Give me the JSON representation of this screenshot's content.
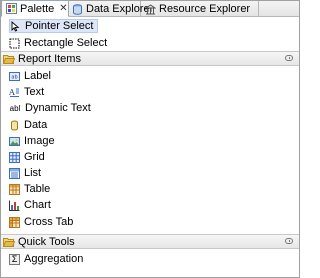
{
  "tabs": [
    {
      "label": "Palette",
      "icon": "palette-icon",
      "active": true
    },
    {
      "label": "Data Explorer",
      "icon": "data-explorer-icon",
      "active": false
    },
    {
      "label": "Resource Explorer",
      "icon": "resource-explorer-icon",
      "active": false
    }
  ],
  "close_glyph": "✕",
  "tools": [
    {
      "label": "Pointer Select",
      "icon": "pointer-icon",
      "selected": true
    },
    {
      "label": "Rectangle Select",
      "icon": "marquee-icon",
      "selected": false
    }
  ],
  "report_items": {
    "title": "Report Items",
    "items": [
      {
        "label": "Label",
        "icon": "label-icon"
      },
      {
        "label": "Text",
        "icon": "text-icon"
      },
      {
        "label": "Dynamic Text",
        "icon": "dynamic-text-icon",
        "glyph": "abl"
      },
      {
        "label": "Data",
        "icon": "data-icon"
      },
      {
        "label": "Image",
        "icon": "image-icon"
      },
      {
        "label": "Grid",
        "icon": "grid-icon"
      },
      {
        "label": "List",
        "icon": "list-icon"
      },
      {
        "label": "Table",
        "icon": "table-icon"
      },
      {
        "label": "Chart",
        "icon": "chart-icon"
      },
      {
        "label": "Cross Tab",
        "icon": "cross-tab-icon"
      }
    ]
  },
  "quick_tools": {
    "title": "Quick Tools",
    "items": [
      {
        "label": "Aggregation",
        "icon": "aggregation-icon",
        "glyph": "Σ"
      }
    ]
  },
  "colors": {
    "selection": "#dce6f6",
    "folder": "#e8b84a",
    "icon_blue": "#3b6fc4"
  }
}
